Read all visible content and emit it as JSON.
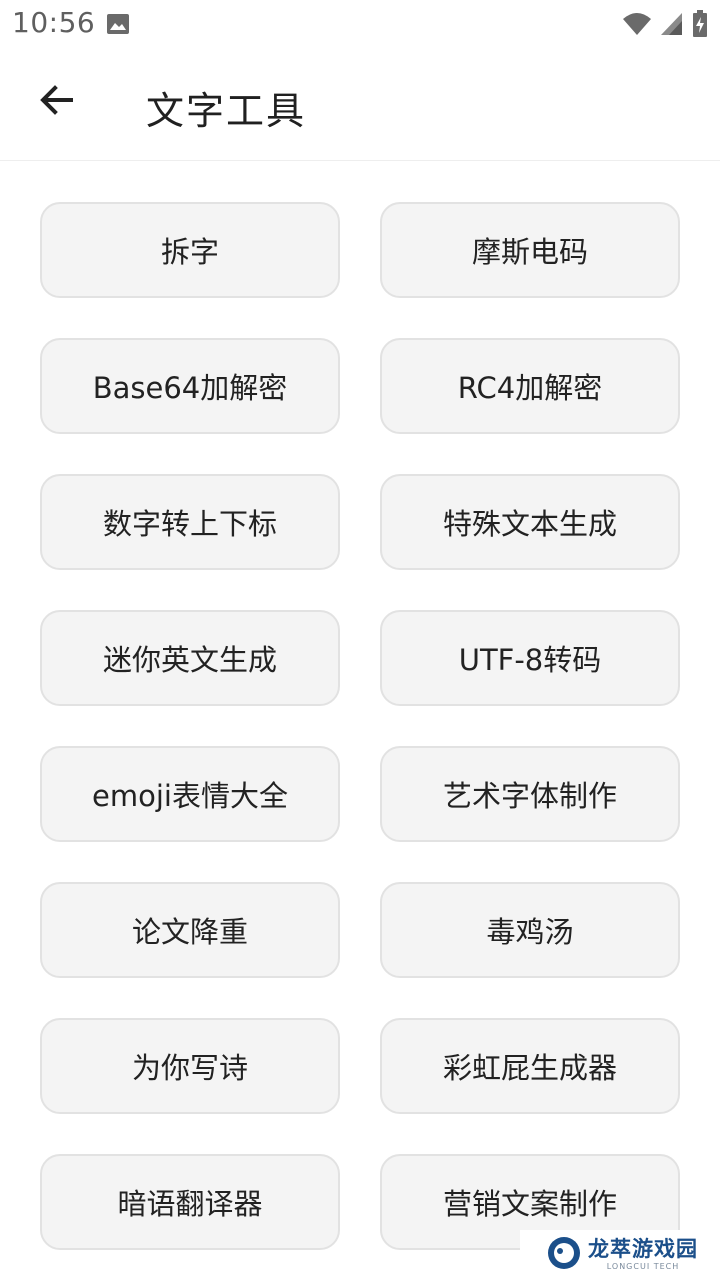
{
  "status_bar": {
    "time": "10:56",
    "icons": [
      "image-icon",
      "wifi-icon",
      "signal-icon",
      "battery-charging-icon"
    ]
  },
  "app_bar": {
    "back_icon": "arrow-left-icon",
    "title": "文字工具"
  },
  "tools": [
    {
      "id": "split-char",
      "label": "拆字"
    },
    {
      "id": "morse-code",
      "label": "摩斯电码"
    },
    {
      "id": "base64",
      "label": "Base64加解密"
    },
    {
      "id": "rc4",
      "label": "RC4加解密"
    },
    {
      "id": "sub-superscript",
      "label": "数字转上下标"
    },
    {
      "id": "special-text",
      "label": "特殊文本生成"
    },
    {
      "id": "mini-english",
      "label": "迷你英文生成"
    },
    {
      "id": "utf8",
      "label": "UTF-8转码"
    },
    {
      "id": "emoji",
      "label": "emoji表情大全"
    },
    {
      "id": "art-font",
      "label": "艺术字体制作"
    },
    {
      "id": "paper-rewrite",
      "label": "论文降重"
    },
    {
      "id": "poison-soup",
      "label": "毒鸡汤"
    },
    {
      "id": "poem",
      "label": "为你写诗"
    },
    {
      "id": "rainbow-fart",
      "label": "彩虹屁生成器"
    },
    {
      "id": "cipher-translate",
      "label": "暗语翻译器"
    },
    {
      "id": "marketing-copy",
      "label": "营销文案制作"
    }
  ],
  "watermark": {
    "name": "龙萃游戏园",
    "sub": "LONGCUI TECH"
  },
  "colors": {
    "button_bg": "#f4f4f4",
    "button_border": "#e2e2e2",
    "watermark_blue": "#1b4f8a"
  }
}
